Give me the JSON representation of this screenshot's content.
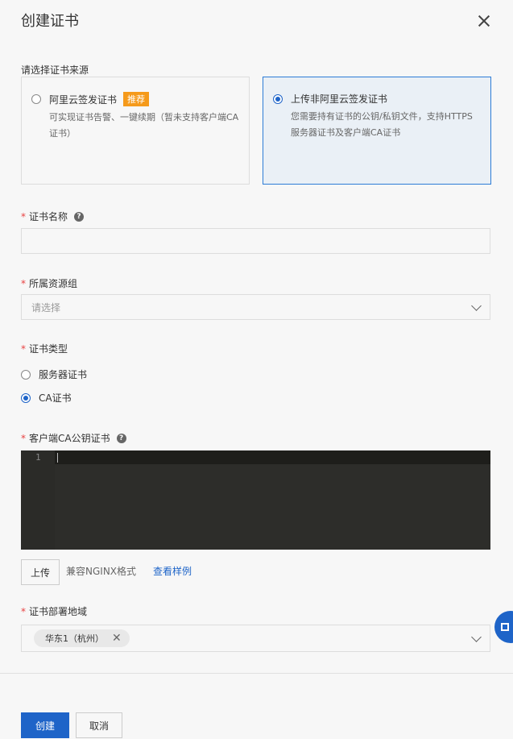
{
  "dialog": {
    "title": "创建证书"
  },
  "source": {
    "label": "请选择证书来源",
    "options": [
      {
        "title": "阿里云签发证书",
        "badge": "推荐",
        "desc": "可实现证书告警、一键续期（暂未支持客户端CA证书）",
        "selected": false
      },
      {
        "title": "上传非阿里云签发证书",
        "desc": "您需要持有证书的公钥/私钥文件，支持HTTPS服务器证书及客户端CA证书",
        "selected": true
      }
    ]
  },
  "cert_name": {
    "label": "证书名称",
    "value": ""
  },
  "resource_group": {
    "label": "所属资源组",
    "placeholder": "请选择"
  },
  "cert_type": {
    "label": "证书类型",
    "options": [
      {
        "label": "服务器证书",
        "selected": false
      },
      {
        "label": "CA证书",
        "selected": true
      }
    ]
  },
  "ca_cert": {
    "label": "客户端CA公钥证书",
    "line_number": "1"
  },
  "upload": {
    "button": "上传",
    "hint": "兼容NGINX格式",
    "link": "查看样例"
  },
  "region": {
    "label": "证书部署地域",
    "tag": "华东1（杭州）"
  },
  "footer": {
    "create": "创建",
    "cancel": "取消"
  },
  "colors": {
    "primary": "#1e64c8",
    "badge": "#f59a1b",
    "required": "#e84343"
  }
}
